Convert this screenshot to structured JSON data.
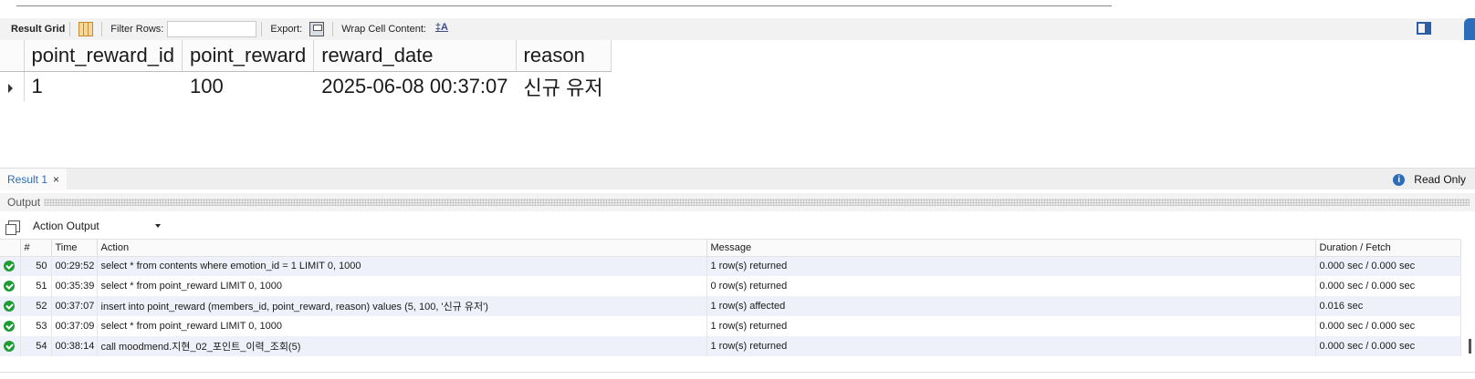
{
  "toolbar": {
    "result_grid": "Result Grid",
    "filter_rows": "Filter Rows:",
    "filter_value": "",
    "export": "Export:",
    "wrap_cell": "Wrap Cell Content:",
    "wrap_icon_text": "‡A"
  },
  "grid": {
    "columns": [
      "point_reward_id",
      "point_reward",
      "reward_date",
      "reason"
    ],
    "rows": [
      [
        "1",
        "100",
        "2025-06-08 00:37:07",
        "신규 유저"
      ]
    ]
  },
  "tabs": {
    "result1": "Result 1",
    "close": "×",
    "read_only": "Read Only",
    "info_glyph": "i"
  },
  "output": {
    "label": "Output",
    "selector_value": "Action Output",
    "columns": [
      "#",
      "Time",
      "Action",
      "Message",
      "Duration / Fetch"
    ],
    "rows": [
      {
        "num": "50",
        "time": "00:29:52",
        "action": "select * from contents where emotion_id = 1 LIMIT 0, 1000",
        "message": "1 row(s) returned",
        "duration": "0.000 sec / 0.000 sec"
      },
      {
        "num": "51",
        "time": "00:35:39",
        "action": "select * from point_reward LIMIT 0, 1000",
        "message": "0 row(s) returned",
        "duration": "0.000 sec / 0.000 sec"
      },
      {
        "num": "52",
        "time": "00:37:07",
        "action": "insert into point_reward (members_id, point_reward, reason) values (5, 100, '신규 유저')",
        "message": "1 row(s) affected",
        "duration": "0.016 sec"
      },
      {
        "num": "53",
        "time": "00:37:09",
        "action": "select * from point_reward LIMIT 0, 1000",
        "message": "1 row(s) returned",
        "duration": "0.000 sec / 0.000 sec"
      },
      {
        "num": "54",
        "time": "00:38:14",
        "action": "call moodmend.지현_02_포인트_이력_조회(5)",
        "message": "1 row(s) returned",
        "duration": "0.000 sec / 0.000 sec"
      }
    ]
  },
  "colors": {
    "accent": "#2b6db8",
    "success": "#1e9b34",
    "alt_row": "#eef1f9"
  }
}
